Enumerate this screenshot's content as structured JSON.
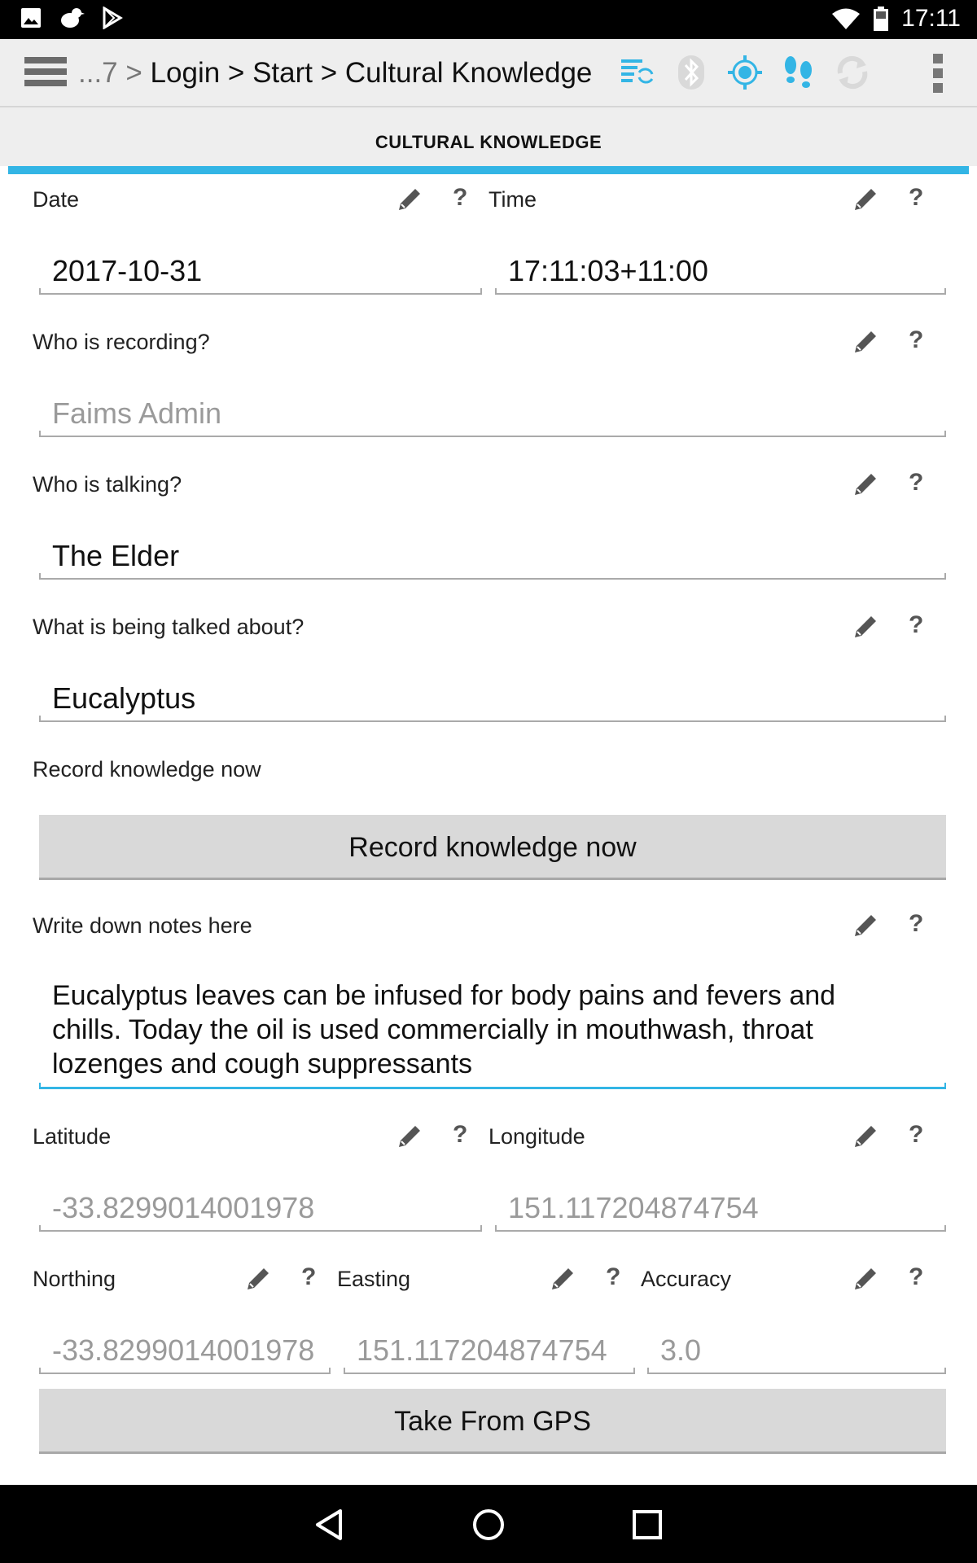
{
  "status": {
    "time": "17:11",
    "icons": [
      "gallery-icon",
      "bird-icon",
      "play-store-icon",
      "wifi-icon",
      "battery-icon"
    ]
  },
  "app": {
    "breadcrumb": {
      "prefix": "...7 >",
      "path": "Login > Start > Cultural Knowledge"
    },
    "toolbar_icons": [
      "sync-list-icon",
      "bluetooth-icon",
      "gps-icon",
      "tracklog-icon",
      "refresh-icon"
    ],
    "colors": {
      "accent": "#33b5e5",
      "tool_active": "#33b5e5",
      "tool_inactive": "#c8c8c8"
    }
  },
  "tab": {
    "title": "CULTURAL KNOWLEDGE"
  },
  "form": {
    "date": {
      "label": "Date",
      "value": "2017-10-31"
    },
    "time": {
      "label": "Time",
      "value": "17:11:03+11:00"
    },
    "recorder": {
      "label": "Who is recording?",
      "placeholder": "Faims Admin"
    },
    "talker": {
      "label": "Who is talking?",
      "value": "The Elder"
    },
    "topic": {
      "label": "What is being talked about?",
      "value": "Eucalyptus"
    },
    "record": {
      "label": "Record knowledge now",
      "button": "Record knowledge now"
    },
    "notes": {
      "label": "Write down notes here",
      "lines": [
        "Eucalyptus leaves can be infused for body pains and fevers and",
        "chills. Today the oil is used commercially in mouthwash, throat",
        "lozenges and cough suppressants"
      ]
    },
    "latitude": {
      "label": "Latitude",
      "placeholder": "-33.8299014001978"
    },
    "longitude": {
      "label": "Longitude",
      "placeholder": "151.117204874754"
    },
    "northing": {
      "label": "Northing",
      "placeholder": "-33.8299014001978"
    },
    "easting": {
      "label": "Easting",
      "placeholder": "151.117204874754"
    },
    "accuracy": {
      "label": "Accuracy",
      "placeholder": "3.0"
    },
    "gps_button": "Take From GPS",
    "help_mark": "?"
  },
  "nav": [
    "back-icon",
    "home-icon",
    "recents-icon"
  ]
}
